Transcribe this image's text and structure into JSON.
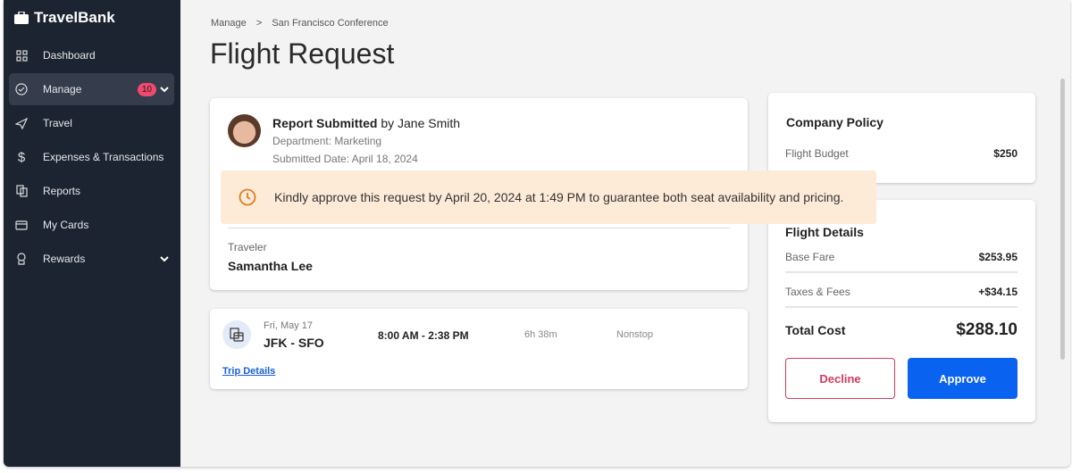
{
  "app": {
    "name": "TravelBank"
  },
  "sidebar": {
    "items": [
      {
        "label": "Dashboard",
        "icon": "dashboard-icon"
      },
      {
        "label": "Manage",
        "icon": "check-circle-icon",
        "badge": "10",
        "active": true
      },
      {
        "label": "Travel",
        "icon": "plane-icon"
      },
      {
        "label": "Expenses & Transactions",
        "icon": "dollar-icon"
      },
      {
        "label": "Reports",
        "icon": "reports-icon"
      },
      {
        "label": "My Cards",
        "icon": "card-icon"
      },
      {
        "label": "Rewards",
        "icon": "award-icon"
      }
    ]
  },
  "breadcrumb": {
    "items": [
      "Manage",
      ">",
      "San Francisco Conference"
    ]
  },
  "page": {
    "title": "Flight Request"
  },
  "report": {
    "title_bold": "Report Submitted",
    "title_rest": " by Jane Smith",
    "department": "Department: Marketing",
    "submitted": "Submitted Date: April 18, 2024"
  },
  "alert": {
    "text": "Kindly approve this request by April 20, 2024 at 1:49 PM to guarantee both seat availability and pricing.",
    "color": "#fdebd8"
  },
  "traveler": {
    "label": "Traveler",
    "name": "Samantha Lee"
  },
  "flight": {
    "date": "Fri, May 17",
    "route": "JFK - SFO",
    "time": "8:00 AM - 2:38 PM",
    "duration": "6h 38m",
    "stops": "Nonstop",
    "link": "Trip Details"
  },
  "policy": {
    "title": "Company Policy",
    "budget_label": "Flight Budget",
    "budget_value": "$250"
  },
  "details": {
    "title": "Flight Details",
    "base_label": "Base Fare",
    "base_value": "$253.95",
    "tax_label": "Taxes & Fees",
    "tax_value": "+$34.15",
    "total_label": "Total Cost",
    "total_value": "$288.10"
  },
  "actions": {
    "decline": "Decline",
    "approve": "Approve"
  },
  "colors": {
    "accent": "#0a62f0",
    "decline": "#d33a5c",
    "sidebar": "#1c2331",
    "badge": "#f0486e"
  }
}
